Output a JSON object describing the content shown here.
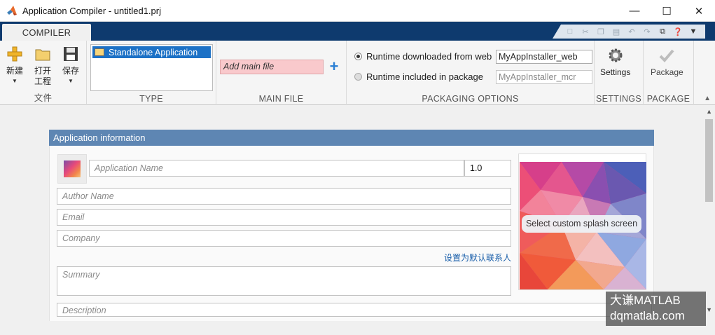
{
  "window": {
    "title": "Application Compiler - untitled1.prj",
    "minimize": "—",
    "maximize": "☐",
    "close": "✕"
  },
  "tabs": [
    {
      "label": "COMPILER"
    }
  ],
  "ribbon": {
    "file_group": {
      "label": "文件",
      "new": "新建",
      "open_line1": "打开",
      "open_line2": "工程",
      "save": "保存"
    },
    "type_group": {
      "label": "TYPE",
      "items": [
        "Standalone Application"
      ]
    },
    "main_file_group": {
      "label": "MAIN FILE",
      "placeholder": "Add main file"
    },
    "packaging_group": {
      "label": "PACKAGING OPTIONS",
      "option_web": "Runtime downloaded from web",
      "option_web_value": "MyAppInstaller_web",
      "option_pkg": "Runtime included in package",
      "option_pkg_value": "MyAppInstaller_mcr"
    },
    "settings_group": {
      "label": "SETTINGS",
      "button": "Settings"
    },
    "package_group": {
      "label": "PACKAGE",
      "button": "Package"
    }
  },
  "app_info": {
    "header": "Application information",
    "app_name_placeholder": "Application Name",
    "version": "1.0",
    "author_placeholder": "Author Name",
    "email_placeholder": "Email",
    "company_placeholder": "Company",
    "set_default_contact": "设置为默认联系人",
    "summary_placeholder": "Summary",
    "description_placeholder": "Description",
    "splash_button": "Select custom splash screen"
  },
  "watermark": {
    "line1": "大谦MATLAB",
    "line2": "dqmatlab.com"
  },
  "colors": {
    "tab_strip": "#0e3a6e",
    "panel_header": "#5e86b3",
    "selection": "#1c71c6",
    "main_file_bg": "#f9c9cc"
  }
}
